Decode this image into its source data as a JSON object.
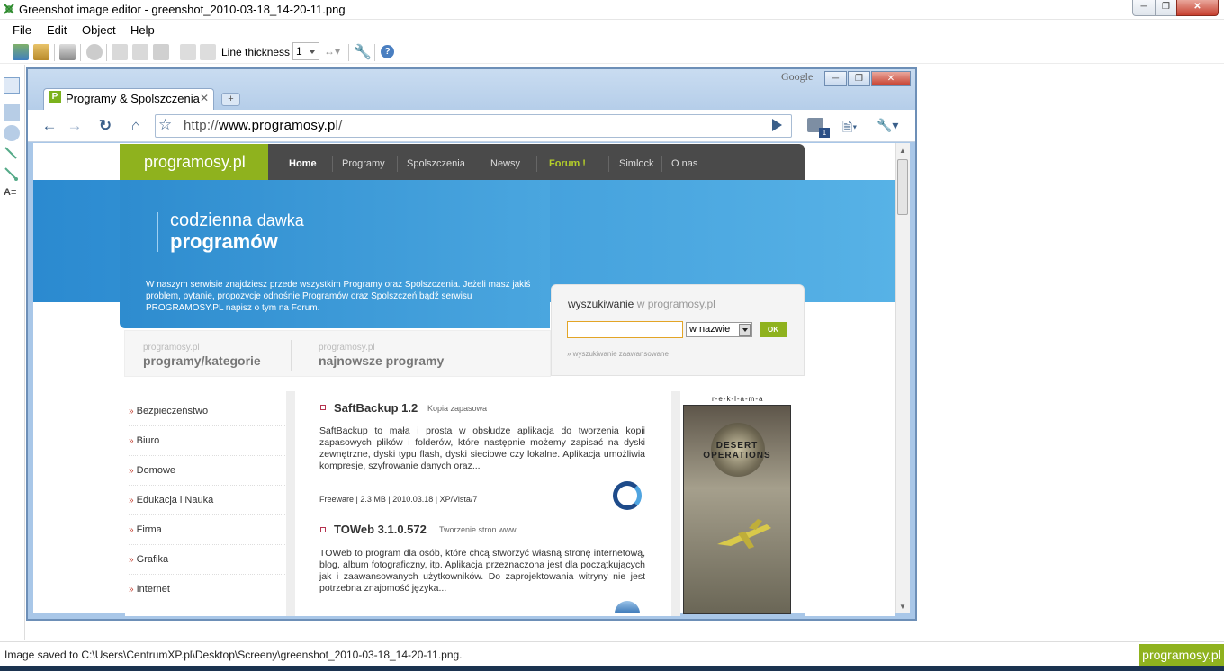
{
  "window": {
    "title": "Greenshot image editor - greenshot_2010-03-18_14-20-11.png"
  },
  "menu": [
    "File",
    "Edit",
    "Object",
    "Help"
  ],
  "toolbar": {
    "line_thickness_label": "Line thickness",
    "line_thickness_value": "1"
  },
  "browser": {
    "google_label": "Google",
    "tab_title": "Programy & Spolszczenia",
    "tab_favicon": "P",
    "url_prefix": "http://",
    "url_host": "www.programosy.pl",
    "url_suffix": "/",
    "badge": "1"
  },
  "site": {
    "logo": "programosy.pl",
    "nav": [
      "Home",
      "Programy",
      "Spolszczenia",
      "Newsy",
      "Forum !",
      "Simlock",
      "O nas"
    ],
    "hero_line1a": "codzienna",
    "hero_line1b": "dawka",
    "hero_line2": "programów",
    "hero_desc": "W naszym serwisie znajdziesz przede wszystkim Programy oraz Spolszczenia. Jeżeli masz jakiś problem, pytanie, propozycje odnośnie Programów oraz Spolszczeń bądź serwisu PROGRAMOSY.PL napisz o tym na Forum.",
    "search": {
      "title": "wyszukiwanie",
      "title_suffix": "w programosy.pl",
      "select_value": "w nazwie",
      "ok_label": "OK",
      "advanced": "» wyszukiwanie zaawansowane",
      "input_value": ""
    },
    "categories": [
      {
        "small": "programosy.pl",
        "big": "programy/kategorie"
      },
      {
        "small": "programosy.pl",
        "big": "najnowsze programy"
      }
    ],
    "sidebar": [
      "Bezpieczeństwo",
      "Biuro",
      "Domowe",
      "Edukacja i Nauka",
      "Firma",
      "Grafika",
      "Internet"
    ],
    "sidebar_arrow": "»",
    "programs": [
      {
        "name": "SaftBackup 1.2",
        "category": "Kopia zapasowa",
        "description": "SaftBackup to mała i prosta w obsłudze aplikacja do tworzenia kopii zapasowych plików i folderów, które następnie możemy zapisać na dyski zewnętrzne, dyski typu flash, dyski sieciowe czy lokalne. Aplikacja umożliwia kompresje, szyfrowanie danych oraz...",
        "meta": "Freeware | 2.3 MB | 2010.03.18 | XP/Vista/7"
      },
      {
        "name": "TOWeb 3.1.0.572",
        "category": "Tworzenie stron www",
        "description": "TOWeb to program dla osób, które chcą stworzyć własną stronę internetową, blog, album fotograficzny, itp. Aplikacja przeznaczona jest dla początkujących jak i zaawansowanych użytkowników. Do zaprojektowania witryny nie jest potrzebna znajomość języka..."
      }
    ],
    "ad_label": "r-e-k-l-a-m-a",
    "ad_text": "DESERT OPERATIONS"
  },
  "status": {
    "text": "Image saved to C:\\Users\\CentrumXP.pl\\Desktop\\Screeny\\greenshot_2010-03-18_14-20-11.png.",
    "logo": "programosy.pl"
  },
  "colors": {
    "accent_green": "#8fb21e",
    "hero_blue": "#2e8ccf",
    "nav_dark": "#4a4a4a",
    "forum_link": "#b5cf2a"
  }
}
